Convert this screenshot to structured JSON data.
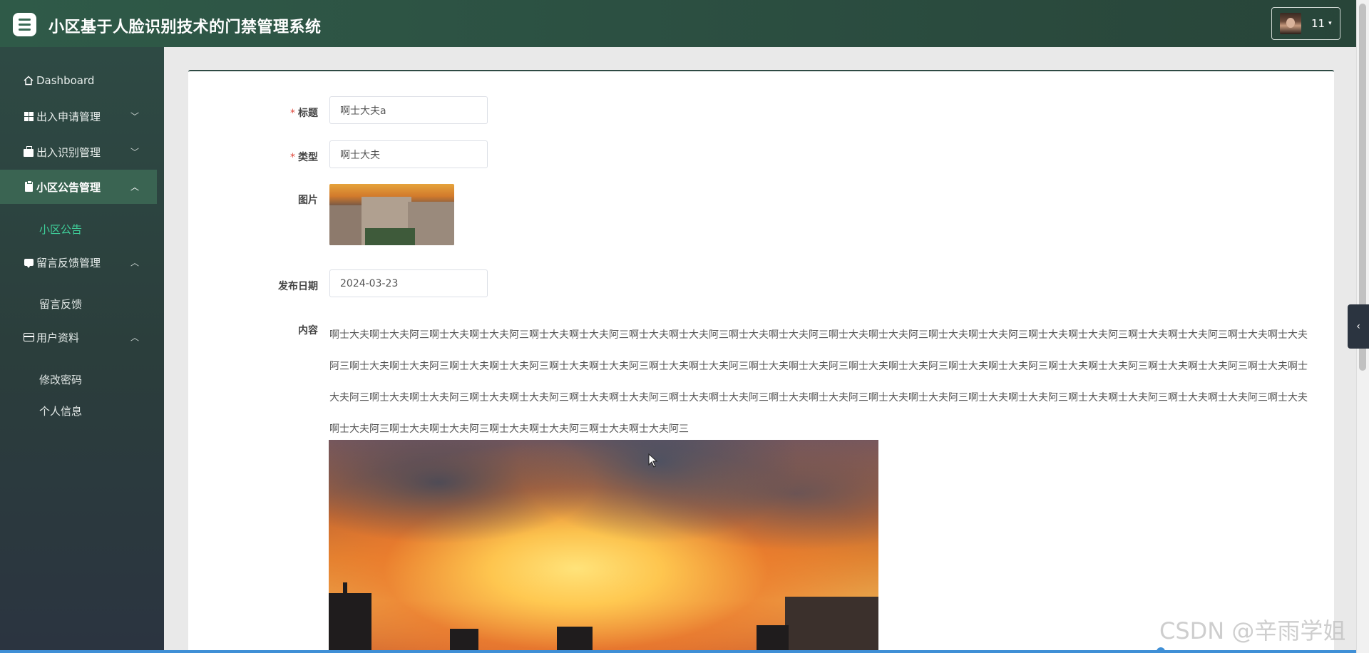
{
  "header": {
    "title": "小区基于人脸识别技术的门禁管理系统",
    "user_name": "11",
    "caret": "▾"
  },
  "sidebar": {
    "items": [
      {
        "label": "Dashboard",
        "icon": "home-icon",
        "chevron": ""
      },
      {
        "label": "出入申请管理",
        "icon": "grid-icon",
        "chevron": "﹀"
      },
      {
        "label": "出入识别管理",
        "icon": "briefcase-icon",
        "chevron": "﹀"
      },
      {
        "label": "小区公告管理",
        "icon": "clipboard-icon",
        "chevron": "︿"
      },
      {
        "label": "留言反馈管理",
        "icon": "message-icon",
        "chevron": "︿"
      },
      {
        "label": "用户资料",
        "icon": "id-card-icon",
        "chevron": "︿"
      }
    ],
    "sub_items": {
      "notice": "小区公告",
      "feedback": "留言反馈",
      "change_password": "修改密码",
      "profile": "个人信息"
    },
    "active_color": "#3fcf9a"
  },
  "form": {
    "title_label": "标题",
    "title_value": "啊士大夫a",
    "type_label": "类型",
    "type_value": "啊士大夫",
    "image_label": "图片",
    "date_label": "发布日期",
    "date_value": "2024-03-23",
    "content_label": "内容",
    "required_mark": "*",
    "content_text": "啊士大夫啊士大夫阿三啊士大夫啊士大夫阿三啊士大夫啊士大夫阿三啊士大夫啊士大夫阿三啊士大夫啊士大夫阿三啊士大夫啊士大夫阿三啊士大夫啊士大夫阿三啊士大夫啊士大夫阿三啊士大夫啊士大夫阿三啊士大夫啊士大夫阿三啊士大夫啊士大夫阿三啊士大夫啊士大夫阿三啊士大夫啊士大夫阿三啊士大夫啊士大夫阿三啊士大夫啊士大夫阿三啊士大夫啊士大夫阿三啊士大夫啊士大夫阿三啊士大夫啊士大夫阿三啊士大夫啊士大夫阿三啊士大夫啊士大夫阿三啊士大夫啊士大夫阿三啊士大夫啊士大夫阿三啊士大夫啊士大夫阿三啊士大夫啊士大夫阿三啊士大夫啊士大夫阿三啊士大夫啊士大夫阿三啊士大夫啊士大夫阿三啊士大夫啊士大夫阿三啊士大夫啊士大夫阿三啊士大夫啊士大夫阿三啊士大夫啊士大夫阿三啊士大夫啊士大夫阿三啊士大夫啊士大夫阿三"
  },
  "watermark": "CSDN @辛雨学姐",
  "side_tab_icon": "‹",
  "colors": {
    "header": "#2f5a48",
    "sidebar": "#2b3e3c",
    "active_nav": "#3a6452",
    "required": "#e04b3f"
  }
}
